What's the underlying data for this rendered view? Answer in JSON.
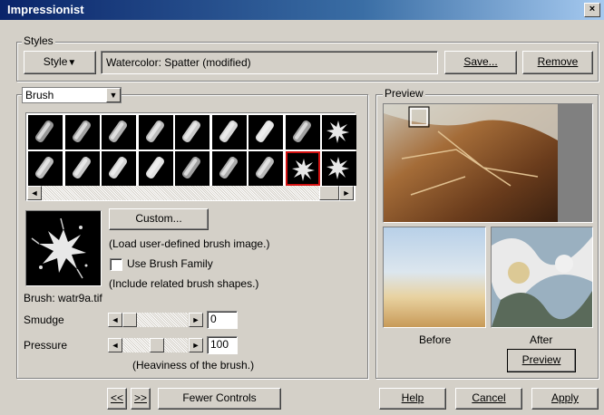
{
  "window": {
    "title": "Impressionist",
    "close_glyph": "×"
  },
  "styles": {
    "group_label": "Styles",
    "style_button": "Style",
    "style_arrow": "▼",
    "current_style": "Watercolor: Spatter (modified)",
    "save_label": "Save...",
    "remove_label": "Remove"
  },
  "brush": {
    "dropdown_value": "Brush",
    "dropdown_arrow": "▼",
    "custom_button": "Custom...",
    "custom_hint": "(Load user-defined brush image.)",
    "use_family_label": "Use Brush Family",
    "family_hint": "(Include related brush shapes.)",
    "brush_name": "Brush: watr9a.tif",
    "smudge_label": "Smudge",
    "smudge_value": "0",
    "pressure_label": "Pressure",
    "pressure_value": "100",
    "pressure_hint": "(Heaviness of the brush.)",
    "selected_index": 16,
    "scroll_left": "◄",
    "scroll_right": "►"
  },
  "preview": {
    "group_label": "Preview",
    "before_label": "Before",
    "after_label": "After",
    "preview_button": "Preview"
  },
  "footer": {
    "back_button": "<<",
    "forward_button": ">>",
    "fewer_controls": "Fewer Controls",
    "help": "Help",
    "cancel": "Cancel",
    "apply": "Apply"
  }
}
